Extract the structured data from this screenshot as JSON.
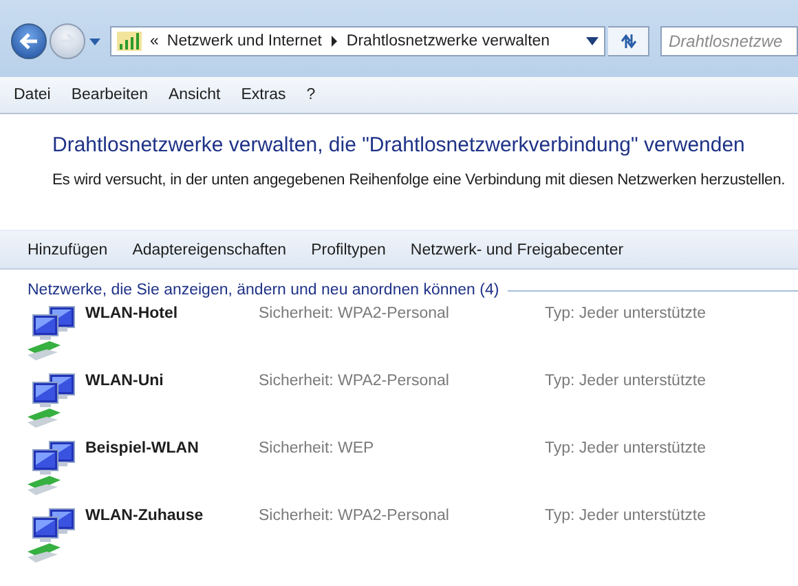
{
  "address_bar": {
    "overflow": "«",
    "breadcrumbs": [
      "Netzwerk und Internet",
      "Drahtlosnetzwerke verwalten"
    ]
  },
  "search": {
    "placeholder": "Drahtlosnetzwe"
  },
  "menu": [
    "Datei",
    "Bearbeiten",
    "Ansicht",
    "Extras",
    "?"
  ],
  "title": "Drahtlosnetzwerke verwalten, die \"Drahtlosnetzwerkverbindung\" verwenden",
  "description": "Es wird versucht, in der unten angegebenen Reihenfolge eine Verbindung mit diesen Netzwerken herzustellen.",
  "toolbar": [
    "Hinzufügen",
    "Adaptereigenschaften",
    "Profiltypen",
    "Netzwerk- und Freigabecenter"
  ],
  "group": {
    "header": "Netzwerke, die Sie anzeigen, ändern und neu anordnen können (4)",
    "networks": [
      {
        "name": "WLAN-Hotel",
        "security": "Sicherheit: WPA2-Personal",
        "type": "Typ: Jeder unterstützte"
      },
      {
        "name": "WLAN-Uni",
        "security": "Sicherheit: WPA2-Personal",
        "type": "Typ: Jeder unterstützte"
      },
      {
        "name": "Beispiel-WLAN",
        "security": "Sicherheit: WEP",
        "type": "Typ: Jeder unterstützte"
      },
      {
        "name": "WLAN-Zuhause",
        "security": "Sicherheit: WPA2-Personal",
        "type": "Typ: Jeder unterstützte"
      }
    ]
  }
}
